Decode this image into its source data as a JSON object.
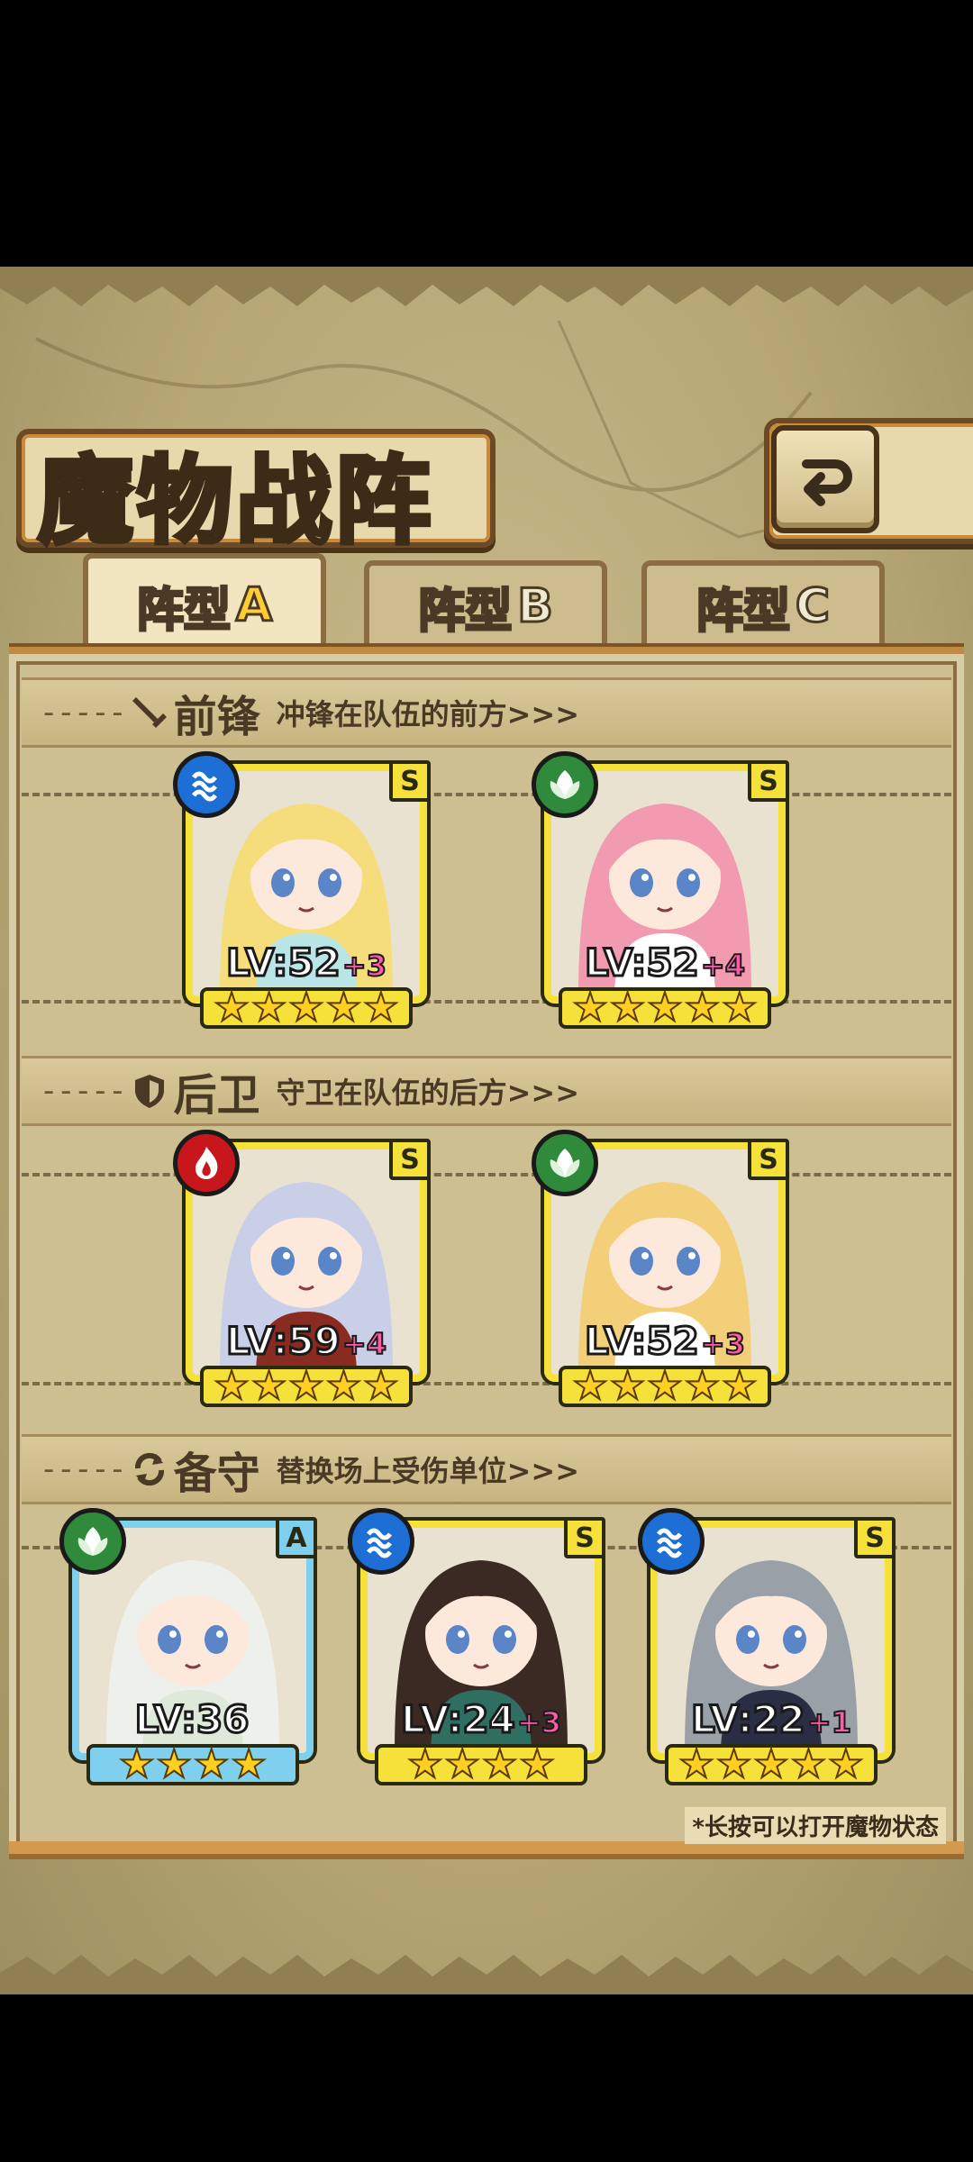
{
  "title": "魔物战阵",
  "back_label": "返回",
  "tabs": [
    {
      "label": "阵型",
      "suffix": "A",
      "active": true
    },
    {
      "label": "阵型",
      "suffix": "B",
      "active": false
    },
    {
      "label": "阵型",
      "suffix": "C",
      "active": false
    }
  ],
  "sections": {
    "vanguard": {
      "name": "前锋",
      "desc": "冲锋在队伍的前方>>>"
    },
    "rearguard": {
      "name": "后卫",
      "desc": "守卫在队伍的后方>>>"
    },
    "reserve": {
      "name": "备守",
      "desc": "替换场上受伤单位>>>"
    }
  },
  "cards": {
    "v1": {
      "element": "water",
      "rank": "S",
      "lv": "LV:52",
      "plus": "+3",
      "stars": 5,
      "colors": {
        "hair": "#f6dd7c",
        "outfit": "#b9e5e6"
      }
    },
    "v2": {
      "element": "leaf",
      "rank": "S",
      "lv": "LV:52",
      "plus": "+4",
      "stars": 5,
      "colors": {
        "hair": "#f29ab0",
        "outfit": "#ffffff"
      }
    },
    "r1": {
      "element": "fire",
      "rank": "S",
      "lv": "LV:59",
      "plus": "+4",
      "stars": 5,
      "colors": {
        "hair": "#c9cfe6",
        "outfit": "#8a2b22"
      }
    },
    "r2": {
      "element": "leaf",
      "rank": "S",
      "lv": "LV:52",
      "plus": "+3",
      "stars": 5,
      "colors": {
        "hair": "#f4cf7a",
        "outfit": "#ffffff"
      }
    },
    "b1": {
      "element": "leaf",
      "rank": "A",
      "lv": "LV:36",
      "plus": "",
      "stars": 4,
      "colors": {
        "hair": "#eef0ec",
        "outfit": "#dfe9da"
      }
    },
    "b2": {
      "element": "water",
      "rank": "S",
      "lv": "LV:24",
      "plus": "+3",
      "stars": 4,
      "colors": {
        "hair": "#3b2a24",
        "outfit": "#2f6f62"
      }
    },
    "b3": {
      "element": "water",
      "rank": "S",
      "lv": "LV:22",
      "plus": "+1",
      "stars": 5,
      "colors": {
        "hair": "#9aa0a8",
        "outfit": "#2b2d45"
      }
    }
  },
  "footer_hint": "*长按可以打开魔物状态"
}
